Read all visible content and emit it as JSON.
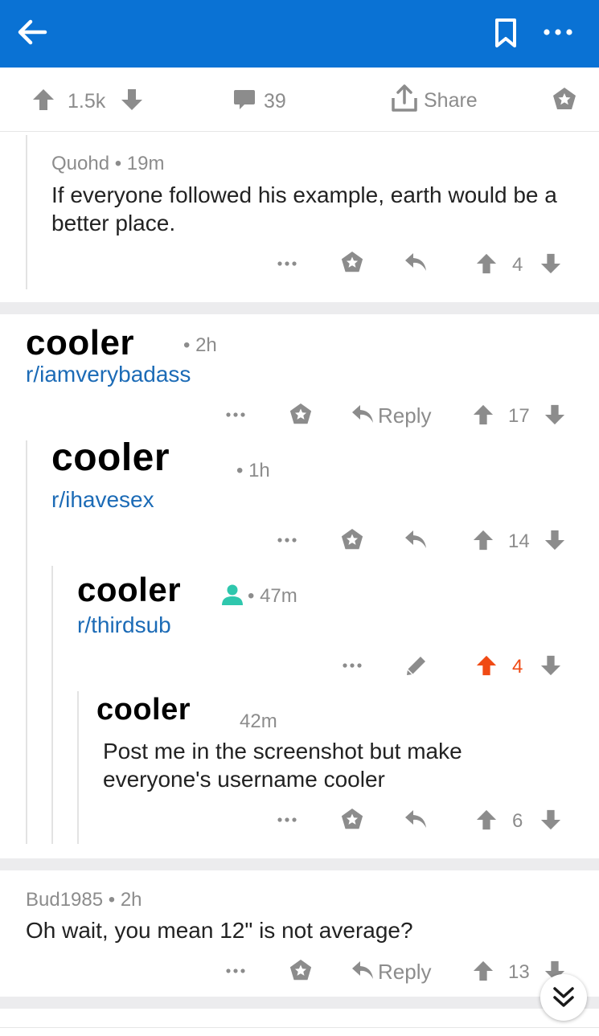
{
  "colors": {
    "appbar": "#0a72d4",
    "icon_gray": "#8c8c8c",
    "link_blue": "#1c6bb6",
    "upvoted": "#f04a14",
    "mod_green": "#2fc7ad"
  },
  "post_actions": {
    "votes": "1.5k",
    "comments": "39",
    "share_label": "Share"
  },
  "comments": [
    {
      "author": "Quohd",
      "time": "• 19m",
      "text": "If everyone followed his example, earth would be a better place.",
      "score": "4"
    },
    {
      "author": "cooler",
      "time": "• 2h",
      "subreddit": "r/iamverybadass",
      "reply_label": "Reply",
      "score": "17"
    },
    {
      "author": "cooler",
      "time": "• 1h",
      "subreddit": "r/ihavesex",
      "score": "14"
    },
    {
      "author": "cooler",
      "time": "• 47m",
      "subreddit": "r/thirdsub",
      "score": "4",
      "upvoted": true
    },
    {
      "author": "cooler",
      "time": "42m",
      "text": "Post me in the screenshot but make everyone's username cooler",
      "score": "6"
    },
    {
      "author": "Bud1985",
      "time": "• 2h",
      "text": "Oh wait, you mean 12\" is not average?",
      "reply_label": "Reply",
      "score": "13"
    }
  ],
  "more_glyph": "•••"
}
